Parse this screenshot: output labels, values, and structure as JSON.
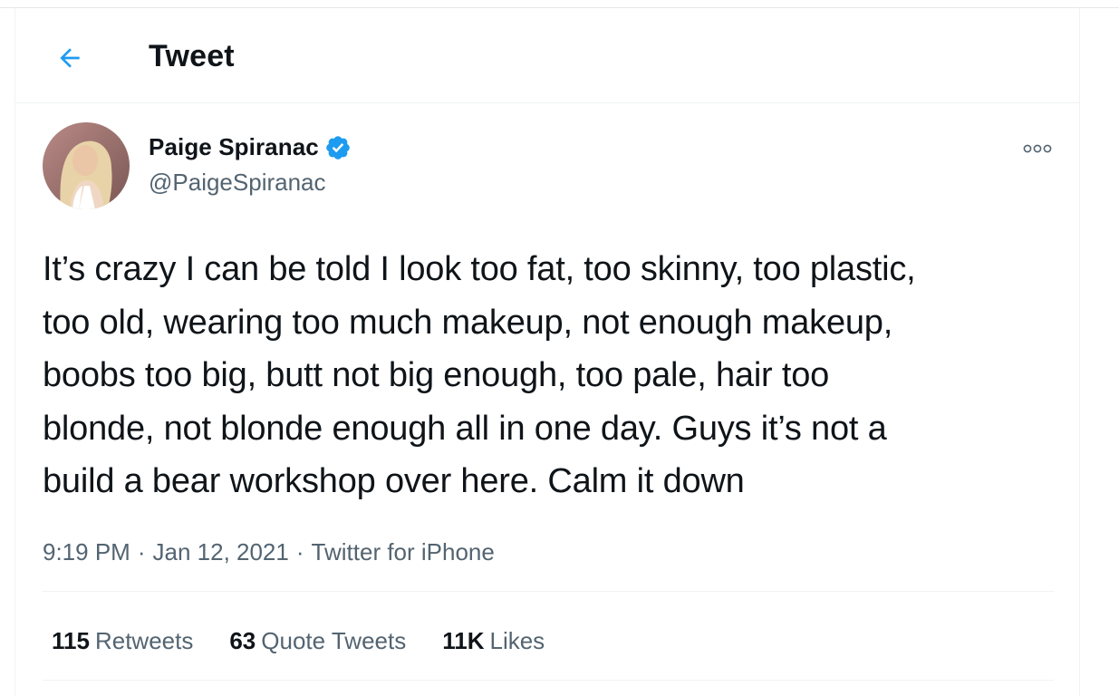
{
  "header": {
    "title": "Tweet",
    "back_icon": "arrow-left-icon"
  },
  "colors": {
    "accent": "#1d9bf0",
    "text_primary": "#0f1419",
    "text_secondary": "#536471",
    "border": "#eff3f4"
  },
  "tweet": {
    "author": {
      "display_name": "Paige Spiranac",
      "handle": "@PaigeSpiranac",
      "verified": true
    },
    "text": "It’s crazy I can be told I look too fat, too skinny, too plastic,\ntoo old, wearing too much makeup, not enough makeup,\nboobs too big, butt not big enough, too pale, hair too\nblonde, not blonde enough all in one day. Guys it’s not a\nbuild a bear workshop over here. Calm it down",
    "meta": {
      "time": "9:19 PM",
      "separator": "·",
      "date": "Jan 12, 2021",
      "source": "Twitter for iPhone"
    },
    "stats": [
      {
        "count": "115",
        "label": "Retweets"
      },
      {
        "count": "63",
        "label": "Quote Tweets"
      },
      {
        "count": "11K",
        "label": "Likes"
      }
    ]
  }
}
